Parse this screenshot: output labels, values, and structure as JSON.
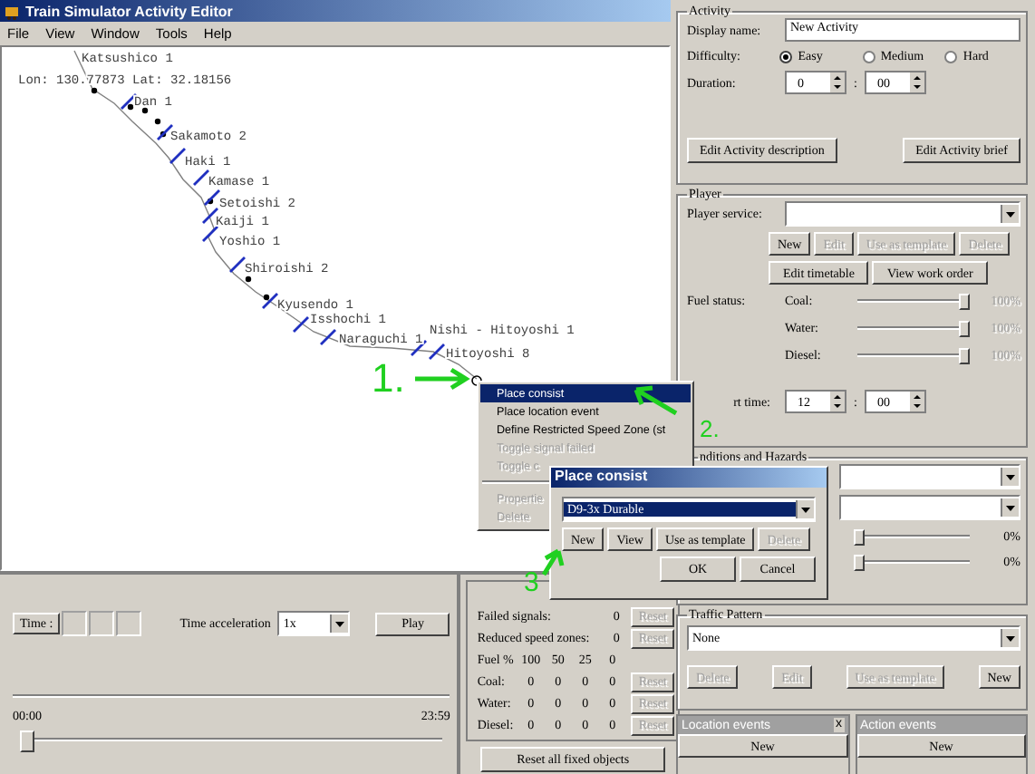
{
  "window": {
    "title": "Train Simulator Activity Editor"
  },
  "menu": [
    "File",
    "View",
    "Window",
    "Tools",
    "Help"
  ],
  "map": {
    "coordinates": "Lon: 130.77873 Lat: 32.18156",
    "stations": [
      "Katsushico 1",
      "Dan 1",
      "Sakamoto 2",
      "Haki 1",
      "Kamase 1",
      "Setoishi 2",
      "Kaiji 1",
      "Yoshio 1",
      "Shiroishi 2",
      "Kyusendo 1",
      "Isshochi 1",
      "Naraguchi 1",
      "Nishi - Hitoyoshi 1",
      "Hitoyoshi 8"
    ]
  },
  "context_menu": [
    {
      "label": "Place consist",
      "selected": true,
      "disabled": false
    },
    {
      "label": "Place location event",
      "selected": false,
      "disabled": false
    },
    {
      "label": "Define Restricted Speed Zone (st",
      "selected": false,
      "disabled": false
    },
    {
      "label": "Toggle signal failed",
      "selected": false,
      "disabled": true
    },
    {
      "label": "Toggle c",
      "selected": false,
      "disabled": true
    },
    {
      "kind": "separator"
    },
    {
      "label": "Propertie",
      "selected": false,
      "disabled": true
    },
    {
      "label": "Delete",
      "selected": false,
      "disabled": true
    }
  ],
  "dialog": {
    "title": "Place consist",
    "consist": "D9-3x Durable",
    "buttons": [
      {
        "label": "New",
        "disabled": false
      },
      {
        "label": "View",
        "disabled": false
      },
      {
        "label": "Use as template",
        "disabled": false
      },
      {
        "label": "Delete",
        "disabled": true
      }
    ],
    "ok": "OK",
    "cancel": "Cancel"
  },
  "annotations": [
    "1.",
    "2.",
    "3"
  ],
  "timeline": {
    "time_button": "Time :",
    "acceleration_label": "Time acceleration",
    "acceleration": "1x",
    "play": "Play",
    "start": "00:00",
    "end": "23:59",
    "level": 0
  },
  "failures": {
    "rows": [
      {
        "label": "Failed signals:",
        "values": [
          "0"
        ],
        "reset": "Reset",
        "disabled": true
      },
      {
        "label": "Reduced speed zones:",
        "values": [
          "0"
        ],
        "reset": "Reset",
        "disabled": true
      }
    ],
    "fuel_header": [
      "Fuel %",
      "100",
      "50",
      "25",
      "0"
    ],
    "fuel_rows": [
      {
        "label": "Coal:",
        "values": [
          "0",
          "0",
          "0",
          "0"
        ],
        "reset": "Reset",
        "disabled": true
      },
      {
        "label": "Water:",
        "values": [
          "0",
          "0",
          "0",
          "0"
        ],
        "reset": "Reset",
        "disabled": true
      },
      {
        "label": "Diesel:",
        "values": [
          "0",
          "0",
          "0",
          "0"
        ],
        "reset": "Reset",
        "disabled": true
      }
    ],
    "reset_all": "Reset all fixed objects"
  },
  "activity": {
    "title": "Activity",
    "name_label": "Display name:",
    "name": "New Activity",
    "difficulty_label": "Difficulty:",
    "difficulty": [
      {
        "label": "Easy",
        "selected": true
      },
      {
        "label": "Medium",
        "selected": false
      },
      {
        "label": "Hard",
        "selected": false
      }
    ],
    "duration_label": "Duration:",
    "hours": "0",
    "separator": ":",
    "minutes": "00",
    "buttons": [
      "Edit Activity description",
      "Edit Activity brief"
    ]
  },
  "player": {
    "title": "Player",
    "service_label": "Player service:",
    "buttons": [
      {
        "label": "New",
        "disabled": false
      },
      {
        "label": "Edit",
        "disabled": true
      },
      {
        "label": "Use as template",
        "disabled": true
      },
      {
        "label": "Delete",
        "disabled": true
      }
    ],
    "buttons2": [
      "Edit timetable",
      "View work order"
    ],
    "fuel_label": "Fuel status:",
    "fuel": [
      {
        "name": "Coal:",
        "level": 1,
        "reading": "100%",
        "disabled": true
      },
      {
        "name": "Water:",
        "level": 1,
        "reading": "100%",
        "disabled": true
      },
      {
        "name": "Diesel:",
        "level": 1,
        "reading": "100%",
        "disabled": true
      }
    ],
    "start_label": "rt time:",
    "hours": "12",
    "separator": ":",
    "minutes": "00"
  },
  "conditions": {
    "title": "nditions and Hazards",
    "sliders": [
      {
        "level": 0,
        "reading": "0%"
      },
      {
        "level": 0,
        "reading": "0%"
      }
    ]
  },
  "traffic": {
    "title": "Traffic Pattern",
    "pattern": "None",
    "buttons": [
      {
        "label": "Delete",
        "disabled": true
      },
      {
        "label": "Edit",
        "disabled": true
      },
      {
        "label": "Use as template",
        "disabled": true
      },
      {
        "label": "New",
        "disabled": false
      }
    ]
  },
  "events": [
    {
      "title": "Location events",
      "close": "x",
      "button": "New"
    },
    {
      "title": "Action events",
      "button": "New"
    }
  ]
}
